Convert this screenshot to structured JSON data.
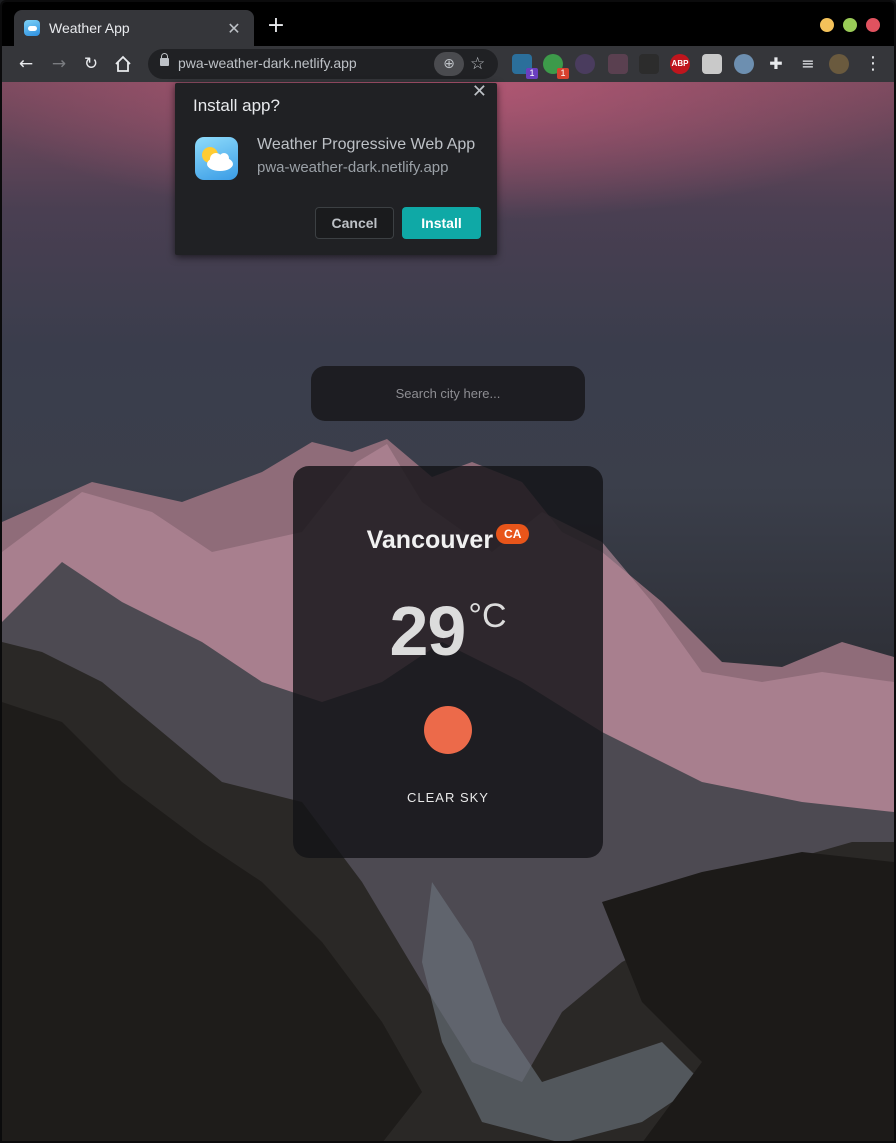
{
  "browser": {
    "tab_title": "Weather App",
    "url": "pwa-weather-dark.netlify.app",
    "window_controls": [
      "minimize",
      "maximize",
      "close"
    ],
    "window_colors": {
      "minimize": "#f4c25a",
      "maximize": "#9acb57",
      "close": "#e0525f"
    },
    "extensions": [
      {
        "name": "ext-1",
        "badge": "1",
        "badge_color": "#6b3fbf"
      },
      {
        "name": "ext-2",
        "badge": "1",
        "badge_color": "#d8412f"
      },
      {
        "name": "ext-3"
      },
      {
        "name": "ext-4"
      },
      {
        "name": "ext-5"
      },
      {
        "name": "adblock-plus",
        "label": "ABP"
      },
      {
        "name": "ext-7"
      },
      {
        "name": "ext-8"
      },
      {
        "name": "extensions-puzzle"
      },
      {
        "name": "media-controls"
      },
      {
        "name": "profile-avatar"
      }
    ]
  },
  "install_dialog": {
    "title": "Install app?",
    "app_name": "Weather Progressive Web App",
    "app_origin": "pwa-weather-dark.netlify.app",
    "cancel_label": "Cancel",
    "install_label": "Install",
    "install_color": "#0fa9a6"
  },
  "search": {
    "placeholder": "Search city here..."
  },
  "weather": {
    "city": "Vancouver",
    "country": "CA",
    "country_color": "#e8551a",
    "temperature": "29",
    "unit": "°C",
    "description": "CLEAR SKY",
    "icon": "clear-sky-sun-icon",
    "icon_color": "#ec6a4a"
  }
}
